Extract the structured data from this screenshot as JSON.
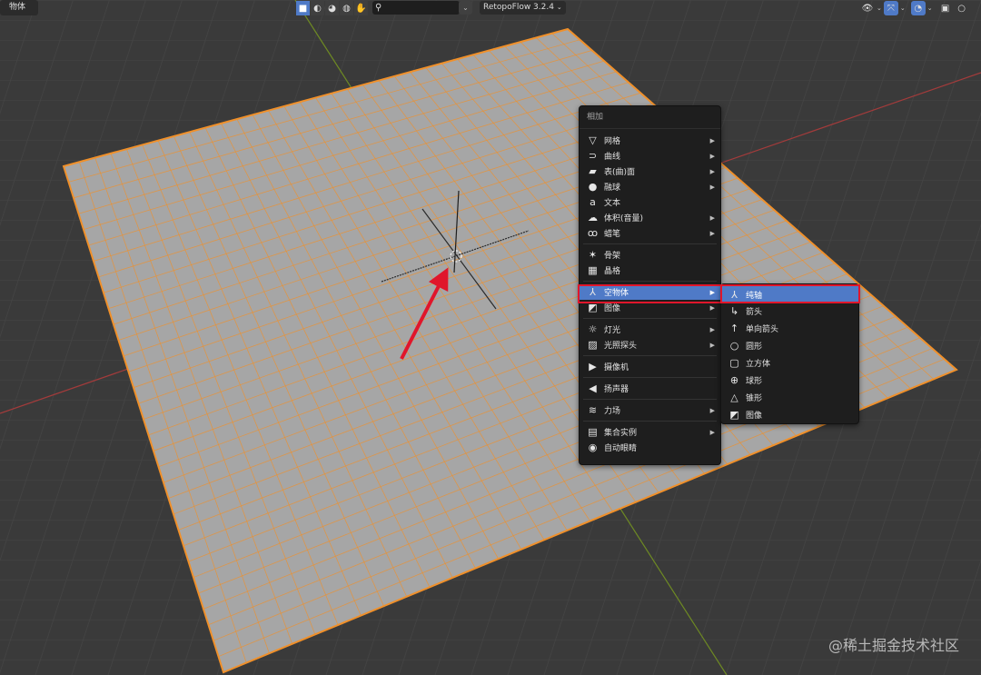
{
  "header": {
    "object_menu": "物体",
    "search": {
      "placeholder": "",
      "value": ""
    },
    "addon_select": "RetopoFlow 3.2.4"
  },
  "add_menu": {
    "title": "相加",
    "items": [
      {
        "label": "网格",
        "icon": "mesh-icon",
        "submenu": true
      },
      {
        "label": "曲线",
        "icon": "curve-icon",
        "submenu": true
      },
      {
        "label": "表(曲)面",
        "icon": "surface-icon",
        "submenu": true
      },
      {
        "label": "融球",
        "icon": "metaball-icon",
        "submenu": true
      },
      {
        "label": "文本",
        "icon": "text-icon",
        "submenu": false
      },
      {
        "label": "体积(音量)",
        "icon": "volume-icon",
        "submenu": true
      },
      {
        "label": "蜡笔",
        "icon": "grease-pencil-icon",
        "submenu": true
      },
      {
        "label": "骨架",
        "icon": "armature-icon",
        "submenu": false
      },
      {
        "label": "晶格",
        "icon": "lattice-icon",
        "submenu": false
      },
      {
        "label": "空物体",
        "icon": "empty-icon",
        "submenu": true
      },
      {
        "label": "图像",
        "icon": "image-icon",
        "submenu": true
      },
      {
        "label": "灯光",
        "icon": "light-icon",
        "submenu": true
      },
      {
        "label": "光照探头",
        "icon": "light-probe-icon",
        "submenu": true
      },
      {
        "label": "摄像机",
        "icon": "camera-icon",
        "submenu": false
      },
      {
        "label": "扬声器",
        "icon": "speaker-icon",
        "submenu": false
      },
      {
        "label": "力场",
        "icon": "force-field-icon",
        "submenu": true
      },
      {
        "label": "集合实例",
        "icon": "collection-icon",
        "submenu": true
      },
      {
        "label": "自动眼睛",
        "icon": "eye-icon",
        "submenu": false
      }
    ]
  },
  "empty_submenu": {
    "items": [
      {
        "label": "纯轴",
        "icon": "plain-axes-icon"
      },
      {
        "label": "箭头",
        "icon": "arrows-icon"
      },
      {
        "label": "单向箭头",
        "icon": "single-arrow-icon"
      },
      {
        "label": "圆形",
        "icon": "circle-icon"
      },
      {
        "label": "立方体",
        "icon": "cube-icon"
      },
      {
        "label": "球形",
        "icon": "sphere-icon"
      },
      {
        "label": "锥形",
        "icon": "cone-icon"
      },
      {
        "label": "图像",
        "icon": "image-icon"
      }
    ]
  },
  "watermark": "@稀土掘金技术社区",
  "colors": {
    "viewport_bg": "#3a3a3a",
    "plane": "#a6a6a6",
    "wire": "#f0902a",
    "highlight": "#4f7ac7",
    "annotation_red": "#e0162b"
  }
}
